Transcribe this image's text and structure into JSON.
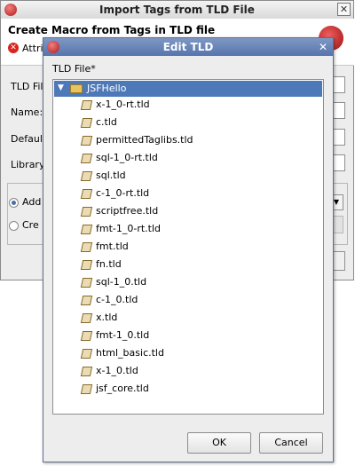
{
  "background_dialog": {
    "title": "Import Tags from TLD File",
    "heading": "Create Macro from Tags in TLD file",
    "error_text": "Attrib",
    "labels": {
      "tld_file": "TLD File",
      "name": "Name:",
      "default": "Default",
      "library": "Library"
    },
    "radio_add": "Add",
    "radio_create": "Cre"
  },
  "edit_dialog": {
    "title": "Edit TLD",
    "field_label": "TLD File*",
    "tree_root": "JSFHello",
    "tree_items": [
      "x-1_0-rt.tld",
      "c.tld",
      "permittedTaglibs.tld",
      "sql-1_0-rt.tld",
      "sql.tld",
      "c-1_0-rt.tld",
      "scriptfree.tld",
      "fmt-1_0-rt.tld",
      "fmt.tld",
      "fn.tld",
      "sql-1_0.tld",
      "c-1_0.tld",
      "x.tld",
      "fmt-1_0.tld",
      "html_basic.tld",
      "x-1_0.tld",
      "jsf_core.tld"
    ],
    "ok_label": "OK",
    "cancel_label": "Cancel"
  },
  "colors": {
    "selection": "#4e79b8",
    "titlebar": "#5675ad"
  }
}
